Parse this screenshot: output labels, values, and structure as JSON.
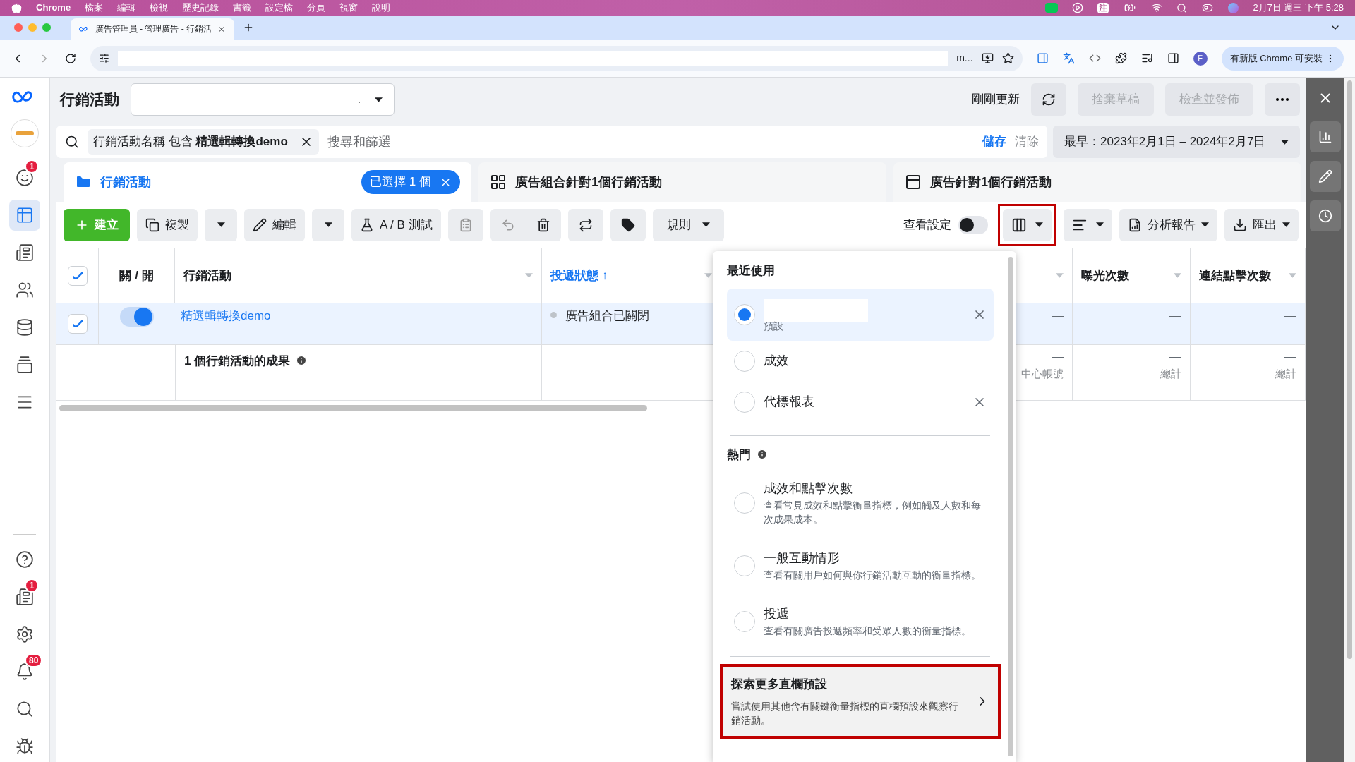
{
  "menubar": {
    "app": "Chrome",
    "items": [
      "檔案",
      "編輯",
      "檢視",
      "歷史記錄",
      "書籤",
      "設定檔",
      "分頁",
      "視窗",
      "說明"
    ],
    "input_method": "注",
    "clock": "2月7日 週三 下午 5:28"
  },
  "browser": {
    "tab_title": "廣告管理員 - 管理廣告 - 行銷活",
    "omnibox_text": "m...",
    "profile_initial": "F",
    "update_button": "有新版 Chrome 可安裝"
  },
  "sidebar": {
    "items": [
      {
        "kind": "chat",
        "selected": false,
        "badge": "1"
      },
      {
        "kind": "table",
        "selected": true
      },
      {
        "kind": "pages",
        "selected": false
      },
      {
        "kind": "people",
        "selected": false
      },
      {
        "kind": "database",
        "selected": false
      },
      {
        "kind": "catalog",
        "selected": false
      },
      {
        "kind": "menu",
        "selected": false
      }
    ],
    "bottom_items": [
      {
        "kind": "help",
        "selected": false
      },
      {
        "kind": "news",
        "selected": false,
        "badge": "1"
      },
      {
        "kind": "settings",
        "selected": false
      },
      {
        "kind": "bell",
        "selected": false,
        "badge": "80"
      },
      {
        "kind": "search",
        "selected": false
      },
      {
        "kind": "bug",
        "selected": false
      }
    ]
  },
  "header": {
    "title": "行銷活動",
    "dropdown_value": ".",
    "status": "剛剛更新",
    "buttons": [
      {
        "label": "捨棄草稿",
        "disabled": true
      },
      {
        "label": "檢查並發佈",
        "disabled": true
      }
    ]
  },
  "search": {
    "chip": "行銷活動名稱 包含 **精選輯轉換demo**",
    "placeholder": "搜尋和篩選",
    "save": "儲存",
    "clear": "清除",
    "date_range": "最早：2023年2月1日 – 2024年2月7日"
  },
  "level_tabs": [
    {
      "label": "行銷活動",
      "selected": true,
      "selection_pill": "已選擇 1 個"
    },
    {
      "label": "廣告組合針對1個行銷活動",
      "selected": false
    },
    {
      "label": "廣告針對1個行銷活動",
      "selected": false
    }
  ],
  "toolbar": {
    "create": "建立",
    "duplicate": "複製",
    "edit": "編輯",
    "ab_test": "A / B 測試",
    "rules": "規則",
    "view_setting": "查看設定",
    "view_setting_on": false,
    "report": "分析報告",
    "export": "匯出"
  },
  "table": {
    "header_checked": true,
    "columns": [
      {
        "label": "關 / 開",
        "sorted": false
      },
      {
        "label": "行銷活動",
        "sorted": false
      },
      {
        "label": "投遞狀態 ↑",
        "sorted": true
      },
      {
        "sorted": false
      },
      {
        "label": "曝光次數",
        "sorted": false
      },
      {
        "label": "連結點擊次數",
        "sorted": false
      }
    ],
    "rows": [
      {
        "checked": true,
        "on": true,
        "campaign": "精選輯轉換demo",
        "delivery": "廣告組合已關閉",
        "column_4": "—",
        "impressions": "—",
        "link_clicks": "—"
      }
    ],
    "summary": {
      "label": "1 個行銷活動的成果",
      "column_4": "—",
      "column_4_note": "中心帳號",
      "impressions": "—",
      "impressions_note": "總計",
      "link_clicks": "—",
      "link_clicks_note": "總計"
    }
  },
  "column_presets_menu": {
    "recent_title": "最近使用",
    "recent": [
      {
        "subtitle": "預設",
        "selected": true,
        "removable": true
      },
      {
        "label": "成效",
        "selected": false,
        "removable": false
      },
      {
        "label": "代標報表",
        "selected": false,
        "removable": true
      }
    ],
    "popular_title": "熱門",
    "popular": [
      {
        "label": "成效和點擊次數",
        "description": "查看常見成效和點擊衡量指標，例如觸及人數和每次成果成本。",
        "selected": false
      },
      {
        "label": "一般互動情形",
        "description": "查看有關用戶如何與你行銷活動互動的衡量指標。",
        "selected": false
      },
      {
        "label": "投遞",
        "description": "查看有關廣告投遞頻率和受眾人數的衡量指標。",
        "selected": false
      }
    ],
    "explore": {
      "title": "探索更多直欄預設",
      "description": "嘗試使用其他含有關鍵衡量指標的直欄預設來觀察行銷活動。"
    }
  }
}
